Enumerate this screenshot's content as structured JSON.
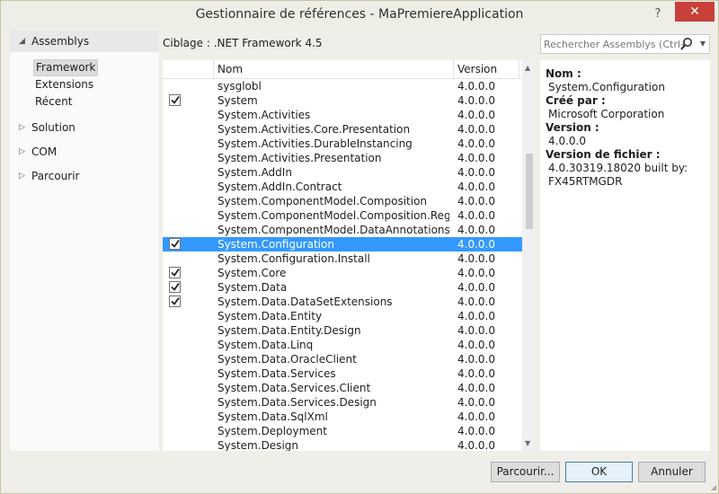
{
  "window": {
    "title": "Gestionnaire de références - MaPremiereApplication",
    "help_label": "?",
    "close_label": "✕"
  },
  "left_nav": {
    "assemblys": {
      "label": "Assemblys",
      "children": [
        "Framework",
        "Extensions",
        "Récent"
      ]
    },
    "solution": {
      "label": "Solution"
    },
    "com": {
      "label": "COM"
    },
    "parcourir": {
      "label": "Parcourir"
    }
  },
  "target_label": "Ciblage : .NET Framework 4.5",
  "search": {
    "placeholder": "Rechercher Assemblys (Ctrl+E)",
    "icon": "search-icon"
  },
  "list": {
    "headers": {
      "name": "Nom",
      "version": "Version"
    },
    "rows": [
      {
        "name": "sysglobl",
        "version": "4.0.0.0",
        "checked": false,
        "selected": false
      },
      {
        "name": "System",
        "version": "4.0.0.0",
        "checked": true,
        "selected": false
      },
      {
        "name": "System.Activities",
        "version": "4.0.0.0",
        "checked": false,
        "selected": false
      },
      {
        "name": "System.Activities.Core.Presentation",
        "version": "4.0.0.0",
        "checked": false,
        "selected": false
      },
      {
        "name": "System.Activities.DurableInstancing",
        "version": "4.0.0.0",
        "checked": false,
        "selected": false
      },
      {
        "name": "System.Activities.Presentation",
        "version": "4.0.0.0",
        "checked": false,
        "selected": false
      },
      {
        "name": "System.AddIn",
        "version": "4.0.0.0",
        "checked": false,
        "selected": false
      },
      {
        "name": "System.AddIn.Contract",
        "version": "4.0.0.0",
        "checked": false,
        "selected": false
      },
      {
        "name": "System.ComponentModel.Composition",
        "version": "4.0.0.0",
        "checked": false,
        "selected": false
      },
      {
        "name": "System.ComponentModel.Composition.Regist...",
        "version": "4.0.0.0",
        "checked": false,
        "selected": false
      },
      {
        "name": "System.ComponentModel.DataAnnotations",
        "version": "4.0.0.0",
        "checked": false,
        "selected": false
      },
      {
        "name": "System.Configuration",
        "version": "4.0.0.0",
        "checked": true,
        "selected": true
      },
      {
        "name": "System.Configuration.Install",
        "version": "4.0.0.0",
        "checked": false,
        "selected": false
      },
      {
        "name": "System.Core",
        "version": "4.0.0.0",
        "checked": true,
        "selected": false
      },
      {
        "name": "System.Data",
        "version": "4.0.0.0",
        "checked": true,
        "selected": false
      },
      {
        "name": "System.Data.DataSetExtensions",
        "version": "4.0.0.0",
        "checked": true,
        "selected": false
      },
      {
        "name": "System.Data.Entity",
        "version": "4.0.0.0",
        "checked": false,
        "selected": false
      },
      {
        "name": "System.Data.Entity.Design",
        "version": "4.0.0.0",
        "checked": false,
        "selected": false
      },
      {
        "name": "System.Data.Linq",
        "version": "4.0.0.0",
        "checked": false,
        "selected": false
      },
      {
        "name": "System.Data.OracleClient",
        "version": "4.0.0.0",
        "checked": false,
        "selected": false
      },
      {
        "name": "System.Data.Services",
        "version": "4.0.0.0",
        "checked": false,
        "selected": false
      },
      {
        "name": "System.Data.Services.Client",
        "version": "4.0.0.0",
        "checked": false,
        "selected": false
      },
      {
        "name": "System.Data.Services.Design",
        "version": "4.0.0.0",
        "checked": false,
        "selected": false
      },
      {
        "name": "System.Data.SqlXml",
        "version": "4.0.0.0",
        "checked": false,
        "selected": false
      },
      {
        "name": "System.Deployment",
        "version": "4.0.0.0",
        "checked": false,
        "selected": false
      },
      {
        "name": "System.Design",
        "version": "4.0.0.0",
        "checked": false,
        "selected": false
      }
    ]
  },
  "details": {
    "name_label": "Nom :",
    "name_value": "System.Configuration",
    "creator_label": "Créé par :",
    "creator_value": "Microsoft Corporation",
    "version_label": "Version :",
    "version_value": "4.0.0.0",
    "file_version_label": "Version de fichier :",
    "file_version_value_1": "4.0.30319.18020 built by:",
    "file_version_value_2": "FX45RTMGDR"
  },
  "buttons": {
    "browse": "Parcourir...",
    "ok": "OK",
    "cancel": "Annuler"
  },
  "colors": {
    "selection": "#3399ff",
    "close": "#c7403a"
  }
}
